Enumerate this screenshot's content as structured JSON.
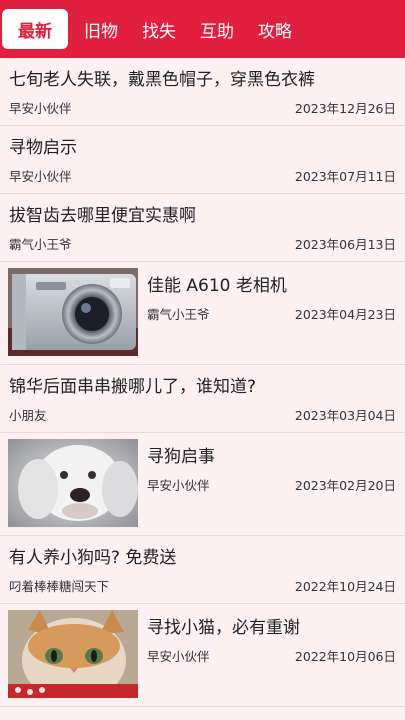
{
  "tabs": [
    {
      "label": "最新",
      "active": true
    },
    {
      "label": "旧物"
    },
    {
      "label": "找失"
    },
    {
      "label": "互助"
    },
    {
      "label": "攻略"
    }
  ],
  "colors": {
    "accent": "#e1203f",
    "background": "#fbf1f3"
  },
  "posts": [
    {
      "title": "七旬老人失联，戴黑色帽子，穿黑色衣裤",
      "author": "早安小伙伴",
      "date": "2023年12月26日"
    },
    {
      "title": "寻物启示",
      "author": "早安小伙伴",
      "date": "2023年07月11日"
    },
    {
      "title": "拔智齿去哪里便宜实惠啊",
      "author": "霸气小王爷",
      "date": "2023年06月13日"
    },
    {
      "title": "佳能 A610 老相机",
      "author": "霸气小王爷",
      "date": "2023年04月23日",
      "image": "camera-photo"
    },
    {
      "title": "锦华后面串串搬哪儿了，谁知道?",
      "author": "小朋友",
      "date": "2023年03月04日"
    },
    {
      "title": "寻狗启事",
      "author": "早安小伙伴",
      "date": "2023年02月20日",
      "image": "dog-photo"
    },
    {
      "title": "有人养小狗吗? 免费送",
      "author": "叼着棒棒糖闯天下",
      "date": "2022年10月24日"
    },
    {
      "title": "寻找小猫，必有重谢",
      "author": "早安小伙伴",
      "date": "2022年10月06日",
      "image": "cat-photo"
    }
  ]
}
